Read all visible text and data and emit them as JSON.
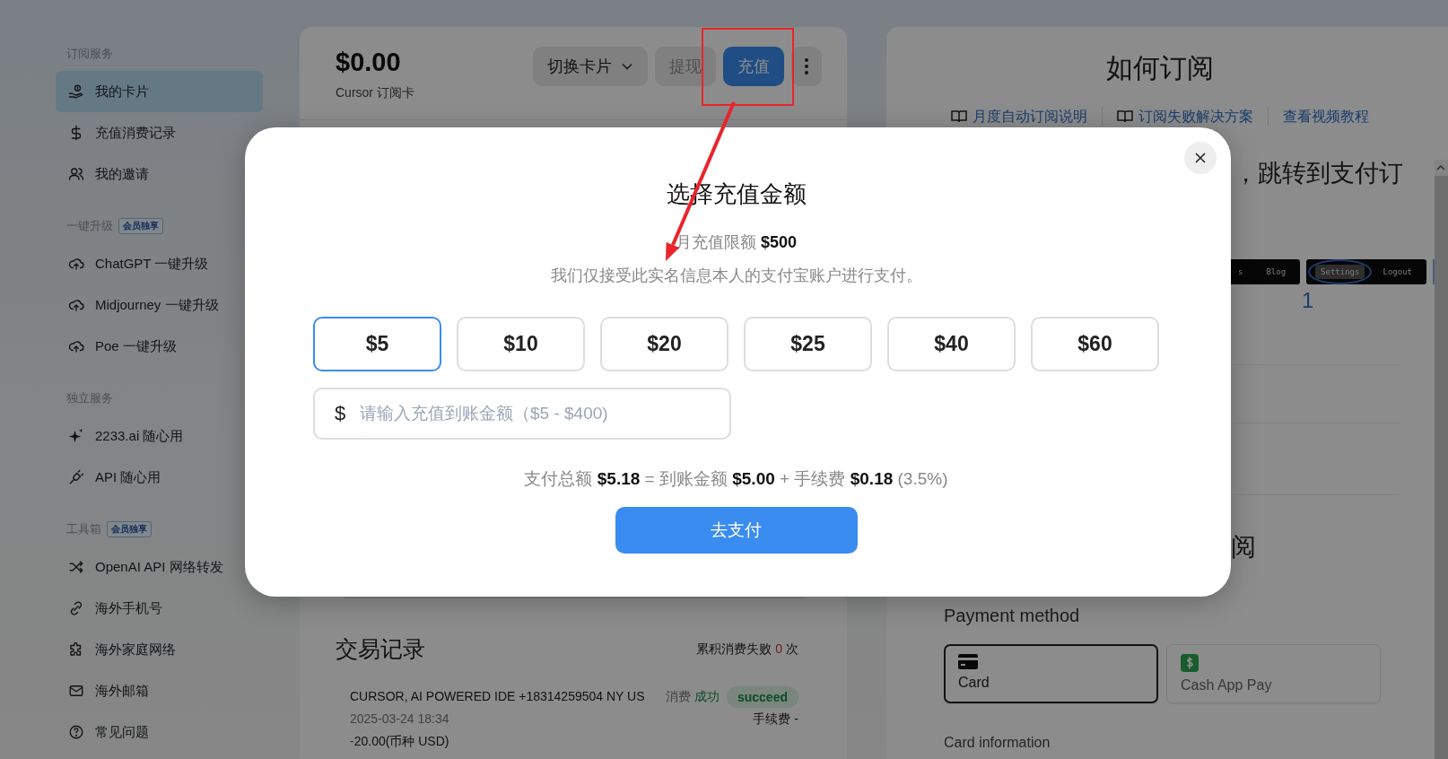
{
  "sidebar": {
    "sections": [
      {
        "title": "订阅服务",
        "items": [
          {
            "label": "我的卡片",
            "selected": true
          },
          {
            "label": "充值消费记录",
            "selected": false
          },
          {
            "label": "我的邀请",
            "selected": false
          }
        ]
      },
      {
        "title": "一键升级",
        "badge": "会员独享",
        "items": [
          {
            "label": "ChatGPT 一键升级",
            "selected": false
          },
          {
            "label": "Midjourney 一键升级",
            "selected": false
          },
          {
            "label": "Poe 一键升级",
            "selected": false
          }
        ]
      },
      {
        "title": "独立服务",
        "items": [
          {
            "label": "2233.ai 随心用",
            "selected": false
          },
          {
            "label": "API 随心用",
            "selected": false
          }
        ]
      },
      {
        "title": "工具箱",
        "badge": "会员独享",
        "items": [
          {
            "label": "OpenAI API 网络转发",
            "selected": false
          },
          {
            "label": "海外手机号",
            "selected": false
          },
          {
            "label": "海外家庭网络",
            "selected": false
          },
          {
            "label": "海外邮箱",
            "selected": false
          },
          {
            "label": "常见问题",
            "selected": false
          }
        ]
      }
    ]
  },
  "card": {
    "balance": "$0.00",
    "name": "Cursor 订阅卡",
    "buttons": [
      {
        "kind": "dropdown",
        "label": "切换卡片",
        "disabled": false
      },
      {
        "kind": "plain",
        "label": "提现",
        "disabled": true
      },
      {
        "kind": "primary",
        "label": "充值",
        "disabled": false
      },
      {
        "kind": "more",
        "disabled": false
      }
    ]
  },
  "transactions": {
    "title": "交易记录",
    "failed_label": "累积消费失败",
    "failed_count": "0",
    "failed_unit": "次",
    "rows": [
      {
        "merchant": "CURSOR, AI POWERED IDE +18314259504 NY US",
        "type": "消费",
        "result": "成功",
        "status": "succeed",
        "time": "2025-03-24 18:34",
        "fee": "手续费 -",
        "sign": "-",
        "amount": "20.00(币种 USD)"
      }
    ]
  },
  "guide": {
    "title": "如何订阅",
    "links": [
      {
        "kind": "doc",
        "label": "月度自动订阅说明"
      },
      {
        "kind": "doc",
        "label": "订阅失败解决方案"
      },
      {
        "kind": "plain",
        "label": "查看视频教程"
      }
    ],
    "step_text": "，跳转到支付订",
    "nav_image": {
      "groups": [
        {
          "items": [
            {
              "label": "s",
              "selected": false
            },
            {
              "label": "Blog",
              "selected": false
            }
          ]
        },
        {
          "items": [
            {
              "label": "Settings",
              "selected": true
            },
            {
              "label": "Logout",
              "selected": false
            }
          ]
        }
      ],
      "marker": "1"
    },
    "section_title": "阅",
    "payment": {
      "title": "Payment method",
      "options": [
        {
          "kind": "card",
          "label": "Card",
          "selected": true
        },
        {
          "kind": "cashapp",
          "label": "Cash App Pay",
          "selected": false
        }
      ],
      "card_info_label": "Card information"
    }
  },
  "modal": {
    "title": "选择充值金额",
    "limit": "月充值限额 **$500**",
    "note": "我们仅接受此实名信息本人的支付宝账户进行支付。",
    "amounts": [
      {
        "label": "$5",
        "selected": true
      },
      {
        "label": "$10",
        "selected": false
      },
      {
        "label": "$20",
        "selected": false
      },
      {
        "label": "$25",
        "selected": false
      },
      {
        "label": "$40",
        "selected": false
      },
      {
        "label": "$60",
        "selected": false
      }
    ],
    "custom": {
      "prefix": "$",
      "placeholder": "请输入充值到账金额（$5 - $400)"
    },
    "summary": "支付总额 **$5.18** = 到账金额 **$5.00** + 手续费 **$0.18** (3.5%)",
    "pay_button": "去支付"
  }
}
